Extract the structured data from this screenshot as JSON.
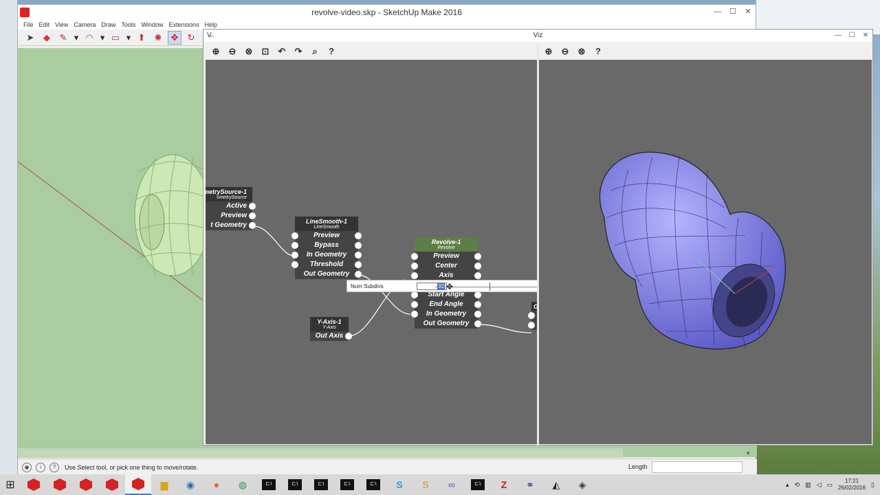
{
  "sketchup": {
    "title": "revolve-video.skp - SketchUp Make 2016",
    "menu": [
      "File",
      "Edit",
      "View",
      "Camera",
      "Draw",
      "Tools",
      "Window",
      "Extensions",
      "Help"
    ],
    "tools": [
      {
        "name": "select-tool-icon",
        "glyph": "➤"
      },
      {
        "name": "eraser-tool-icon",
        "glyph": "◆"
      },
      {
        "name": "pencil-tool-icon",
        "glyph": "✎"
      },
      {
        "name": "pencil-dropdown-icon",
        "glyph": "▾"
      },
      {
        "name": "arc-tool-icon",
        "glyph": "◠"
      },
      {
        "name": "arc-dropdown-icon",
        "glyph": "▾"
      },
      {
        "name": "rectangle-tool-icon",
        "glyph": "▭"
      },
      {
        "name": "rectangle-dropdown-icon",
        "glyph": "▾"
      },
      {
        "name": "push-pull-tool-icon",
        "glyph": "⬆"
      },
      {
        "name": "offset-tool-icon",
        "glyph": "✺"
      },
      {
        "name": "move-tool-icon",
        "glyph": "✥"
      },
      {
        "name": "rotate-tool-icon",
        "glyph": "↻"
      }
    ],
    "status": "Use Select tool, or pick one thing to move/rotate.",
    "length_label": "Length",
    "length_value": ""
  },
  "viz": {
    "title": "Viz",
    "icon": "V̶",
    "graph_toolbar": [
      "zoom-in-icon",
      "zoom-out-icon",
      "zoom-fit-icon",
      "zoom-extents-icon",
      "undo-icon",
      "redo-icon",
      "inspect-icon",
      "help-icon"
    ],
    "render_toolbar": [
      "zoom-in-icon",
      "zoom-out-icon",
      "zoom-fit-icon",
      "help-icon"
    ],
    "nodes": {
      "geometry_source": {
        "title": "metrySource-1",
        "sub": "ometrySource",
        "ports": [
          "Active",
          "Preview",
          "t Geometry"
        ]
      },
      "line_smooth": {
        "title": "LineSmooth-1",
        "sub": "LineSmooth",
        "ports": [
          "Preview",
          "Bypass",
          "In Geometry",
          "Threshold",
          "Out Geometry"
        ]
      },
      "revolve": {
        "title": "Revolve-1",
        "sub": "Revolve",
        "ports": [
          "Preview",
          "Center",
          "Axis",
          "Start Angle",
          "End Angle",
          "In Geometry",
          "Out Geometry"
        ]
      },
      "y_axis": {
        "title": "Y-Axis-1",
        "sub": "Y-Axis",
        "ports": [
          "Out Axis"
        ]
      },
      "partial": {
        "title": "G"
      }
    },
    "param": {
      "label": "Num Subdivs",
      "value": "32",
      "slider_fraction": 0.31
    }
  },
  "taskbar": {
    "clock_time": "17:21",
    "clock_date": "26/02/2016",
    "apps": [
      "sketchup",
      "sketchup",
      "sketchup",
      "sketchup",
      "sketchup",
      "explorer",
      "thunderbird",
      "firefox",
      "chrome",
      "cmd",
      "cmd",
      "cmd",
      "cmd",
      "cmd",
      "skype",
      "sublime",
      "visual-studio",
      "cmd",
      "filezilla",
      "network",
      "inkscape",
      "sketchup-layout"
    ]
  },
  "colors": {
    "viewport": "#a9cca0",
    "graph_bg": "#696969",
    "node_header": "#333333",
    "revolve_header": "#5d7e46",
    "mesh": "#8c8cf0"
  }
}
